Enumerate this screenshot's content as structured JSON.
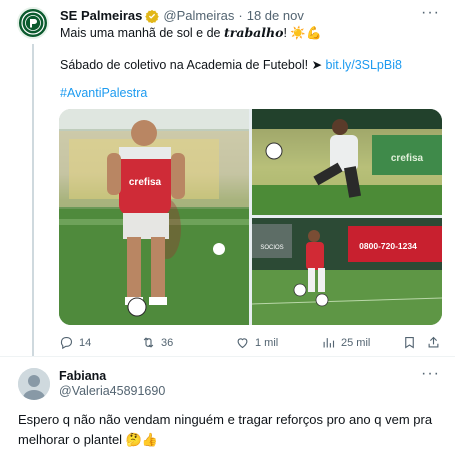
{
  "tweet": {
    "author_name": "SE Palmeiras",
    "handle": "@Palmeiras",
    "separator": "·",
    "date": "18 de nov",
    "line1_prefix": "Mais uma manhã de sol e de ",
    "line1_bold": "trabalho",
    "line1_suffix": "! ☀️💪",
    "line2_text": "Sábado de coletivo na Academia de Futebol! ➤ ",
    "line2_link": "bit.ly/3SLpBi8",
    "hashtag": "#AvantiPalestra",
    "media": {
      "photo1_label": "crefisa",
      "photo2_label": "crefisa",
      "photo3_label": "0800-720-1234",
      "photo3_logo": "SOCIOS"
    },
    "actions": {
      "replies": "14",
      "retweets": "36",
      "likes": "1 mil",
      "views": "25 mil"
    }
  },
  "reply": {
    "author_name": "Fabiana",
    "handle": "@Valeria45891690",
    "text": "Espero q não não vendam ninguém e tragar reforços pro ano q vem pra melhorar o plantel 🤔👍"
  },
  "colors": {
    "accent": "#1d9bf0",
    "muted": "#536471",
    "palmeiras_green": "#0b5a2e"
  }
}
